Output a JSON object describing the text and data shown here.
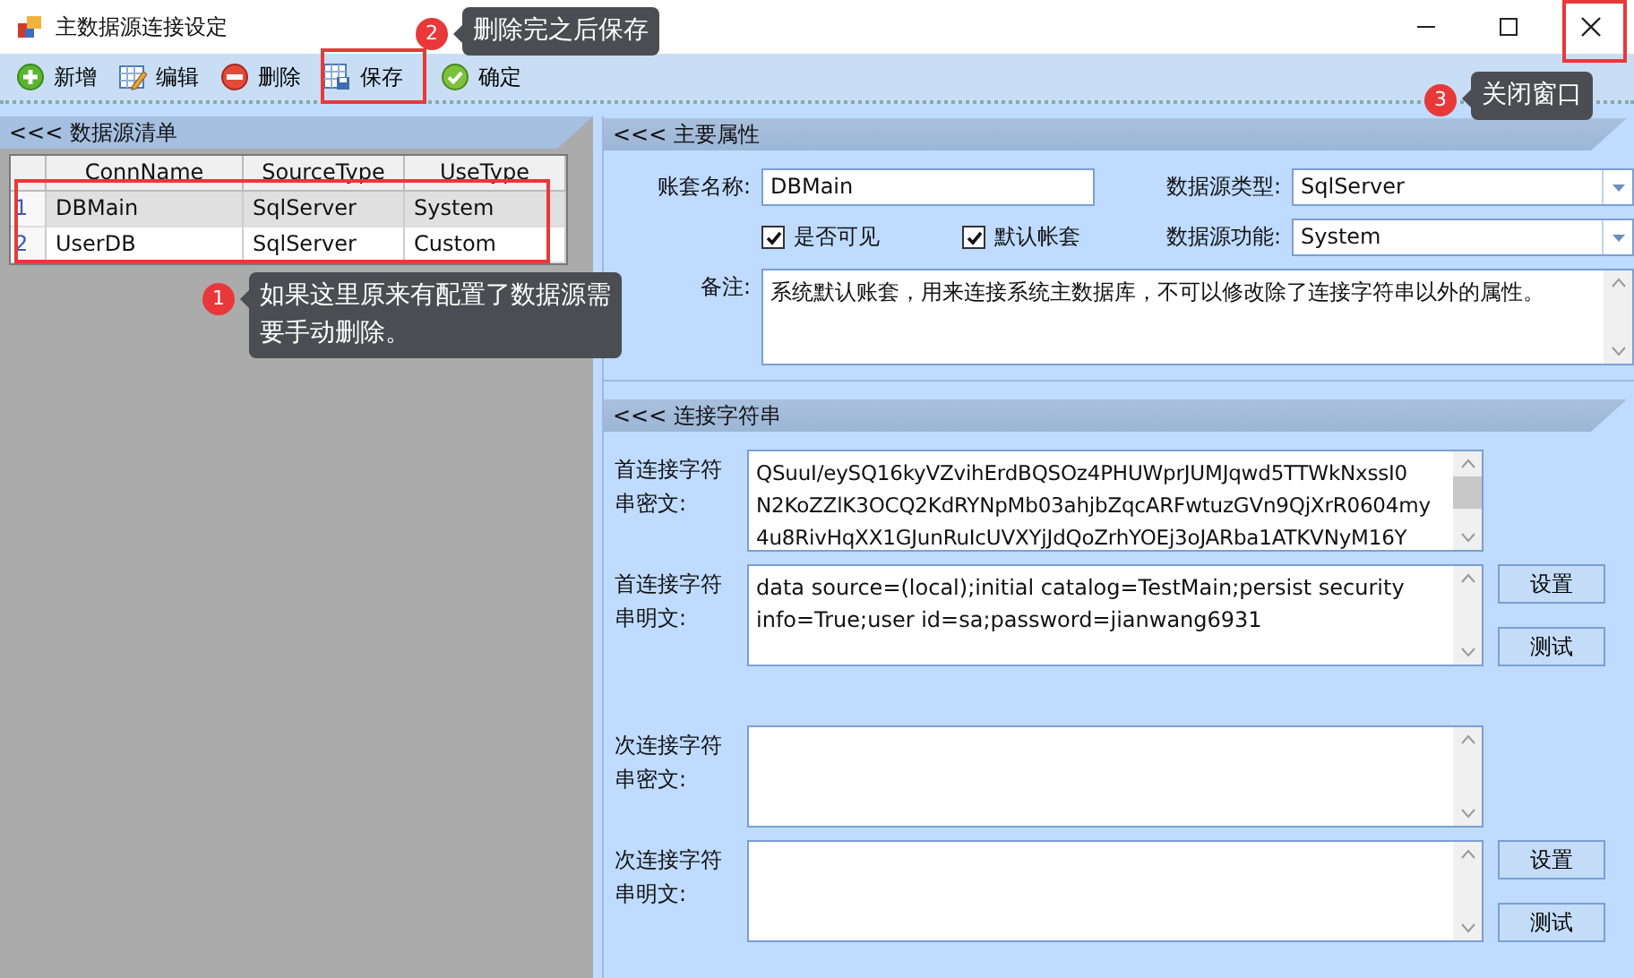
{
  "window": {
    "title": "主数据源连接设定"
  },
  "toolbar": [
    {
      "kind": "add",
      "label": "新增"
    },
    {
      "kind": "edit",
      "label": "编辑"
    },
    {
      "kind": "delete",
      "label": "删除"
    },
    {
      "kind": "save",
      "label": "保存"
    },
    {
      "kind": "confirm",
      "label": "确定"
    }
  ],
  "list_panel": {
    "title": "<<< 数据源清单",
    "columns": [
      "ConnName",
      "SourceType",
      "UseType"
    ],
    "rows": [
      {
        "index": "1",
        "cells": [
          "DBMain",
          "SqlServer",
          "System"
        ],
        "selected": true
      },
      {
        "index": "2",
        "cells": [
          "UserDB",
          "SqlServer",
          "Custom"
        ],
        "selected": false
      }
    ]
  },
  "main_properties": {
    "title": "<<< 主要属性",
    "account_label": "账套名称:",
    "account_value": "DBMain",
    "source_type_label": "数据源类型:",
    "source_type_value": "SqlServer",
    "visible": {
      "label": "是否可见",
      "checked": true
    },
    "default_account": {
      "label": "默认帐套",
      "checked": true
    },
    "source_function_label": "数据源功能:",
    "source_function_value": "System",
    "remark_label": "备注:",
    "remark_value": "系统默认账套，用来连接系统主数据库，不可以修改除了连接字符串以外的属性。"
  },
  "connection_strings": {
    "title": "<<< 连接字符串",
    "fields": [
      {
        "label": "首连接字符串密文:",
        "value": "QSuuI/eySQ16kyVZvihErdBQSOz4PHUWprJUMJqwd5TTWkNxssI0\nN2KoZZlK3OCQ2KdRYNpMb03ahjbZqcARFwtuzGVn9QjXrR0604my\n4u8RivHqXX1GJunRuIcUVXYjJdQoZrhYOEj3oJARba1ATKVNyM16Y"
      },
      {
        "label": "首连接字符串明文:",
        "value": "data source=(local);initial catalog=TestMain;persist security info=True;user id=sa;password=jianwang6931",
        "buttons": [
          "设置",
          "测试"
        ]
      },
      {
        "label": "次连接字符串密文:"
      },
      {
        "label": "次连接字符串明文:",
        "buttons": [
          "设置",
          "测试"
        ]
      }
    ]
  },
  "annotations": [
    {
      "number": "2",
      "text": "删除完之后保存"
    },
    {
      "number": "3",
      "text": "关闭窗口"
    },
    {
      "number": "1",
      "text": "如果这里原来有配置了数据源需要手动删除。"
    }
  ]
}
